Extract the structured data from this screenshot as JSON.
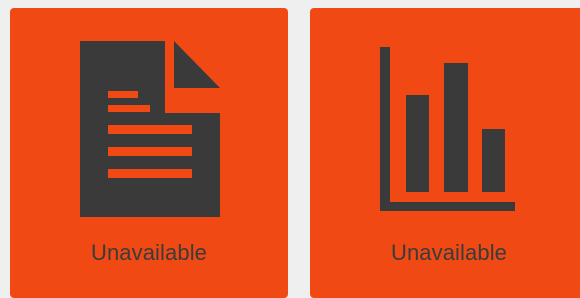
{
  "colors": {
    "background": "#efefef",
    "tile": "#f04914",
    "icon": "#3a3a3a",
    "label": "#3b3b3b"
  },
  "tiles": [
    {
      "label": "Unavailable",
      "icon": "document-icon"
    },
    {
      "label": "Unavailable",
      "icon": "bar-chart-icon"
    }
  ]
}
